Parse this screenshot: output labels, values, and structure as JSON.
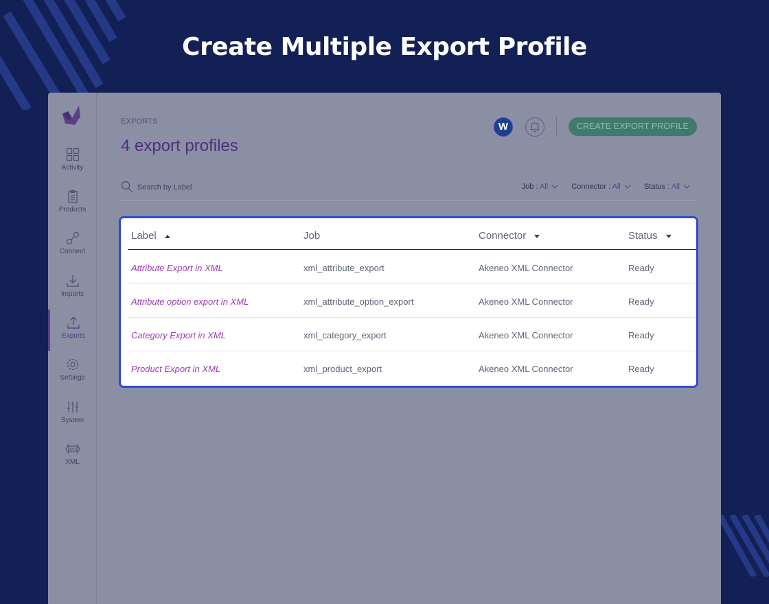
{
  "hero": {
    "title": "Create Multiple Export Profile"
  },
  "sidebar": {
    "items": [
      {
        "label": "Activity",
        "icon": "grid-icon"
      },
      {
        "label": "Products",
        "icon": "clipboard-icon"
      },
      {
        "label": "Connect",
        "icon": "connect-icon"
      },
      {
        "label": "Imports",
        "icon": "download-icon"
      },
      {
        "label": "Exports",
        "icon": "upload-icon",
        "active": true
      },
      {
        "label": "Settings",
        "icon": "gear-icon"
      },
      {
        "label": "System",
        "icon": "sliders-icon"
      },
      {
        "label": "XML",
        "icon": "xml-icon"
      }
    ]
  },
  "header": {
    "breadcrumb": "EXPORTS",
    "title": "4 export profiles",
    "brand_badge": "W",
    "create_button": "CREATE EXPORT PROFILE"
  },
  "search": {
    "placeholder": "Search by Label"
  },
  "filters": [
    {
      "name": "Job",
      "value": "All"
    },
    {
      "name": "Connector",
      "value": "All"
    },
    {
      "name": "Status",
      "value": "All"
    }
  ],
  "table": {
    "columns": [
      "Label",
      "Job",
      "Connector",
      "Status"
    ],
    "rows": [
      [
        "Attribute Export in XML",
        "xml_attribute_export",
        "Akeneo XML Connector",
        "Ready"
      ],
      [
        "Attribute option export in XML",
        "xml_attribute_option_export",
        "Akeneo XML Connector",
        "Ready"
      ],
      [
        "Category Export in XML",
        "xml_category_export",
        "Akeneo XML Connector",
        "Ready"
      ],
      [
        "Product Export in XML",
        "xml_product_export",
        "Akeneo XML Connector",
        "Ready"
      ]
    ]
  },
  "colors": {
    "background": "#122056",
    "accent_purple": "#9d3cb4",
    "highlight_border": "#2f4ad6",
    "button_green": "#3f7a6b"
  }
}
